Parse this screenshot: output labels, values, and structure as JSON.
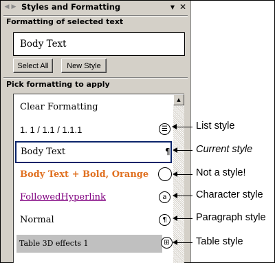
{
  "pane": {
    "title": "Styles and Formatting",
    "nav_back_icon": "back-arrow-icon",
    "nav_forward_icon": "forward-arrow-icon",
    "dropdown_glyph": "▼",
    "close_glyph": "✕"
  },
  "current_section": {
    "label": "Formatting of selected text",
    "value": "Body Text"
  },
  "buttons": {
    "select_all": "Select All",
    "new_style": "New Style"
  },
  "list_section": {
    "label": "Pick formatting to apply",
    "items": [
      {
        "text": "Clear Formatting"
      },
      {
        "text": "1.  1 / 1.1 / 1.1.1",
        "icon": "list-style-icon",
        "glyph": "☰"
      },
      {
        "text": "Body Text",
        "icon": "paragraph-mark-icon",
        "glyph": "¶"
      },
      {
        "text": "Body Text + Bold, Orange",
        "icon": "empty-circle-icon",
        "glyph": ""
      },
      {
        "text": "FollowedHyperlink",
        "icon": "character-style-icon",
        "glyph": "a"
      },
      {
        "text": "Normal",
        "icon": "paragraph-style-icon",
        "glyph": "¶"
      },
      {
        "text": "Table 3D effects 1",
        "icon": "table-style-icon",
        "glyph": "⊞"
      }
    ]
  },
  "callouts": [
    {
      "label": "List style"
    },
    {
      "label": "Current style"
    },
    {
      "label": "Not a style!"
    },
    {
      "label": "Character style"
    },
    {
      "label": "Paragraph style"
    },
    {
      "label": "Table style"
    }
  ],
  "colors": {
    "pane_bg": "#d4d0c8",
    "selection_border": "#0a246a",
    "orange_text": "#e07020",
    "visited_link": "#800080",
    "table_row_bg": "#c0c0c0"
  }
}
